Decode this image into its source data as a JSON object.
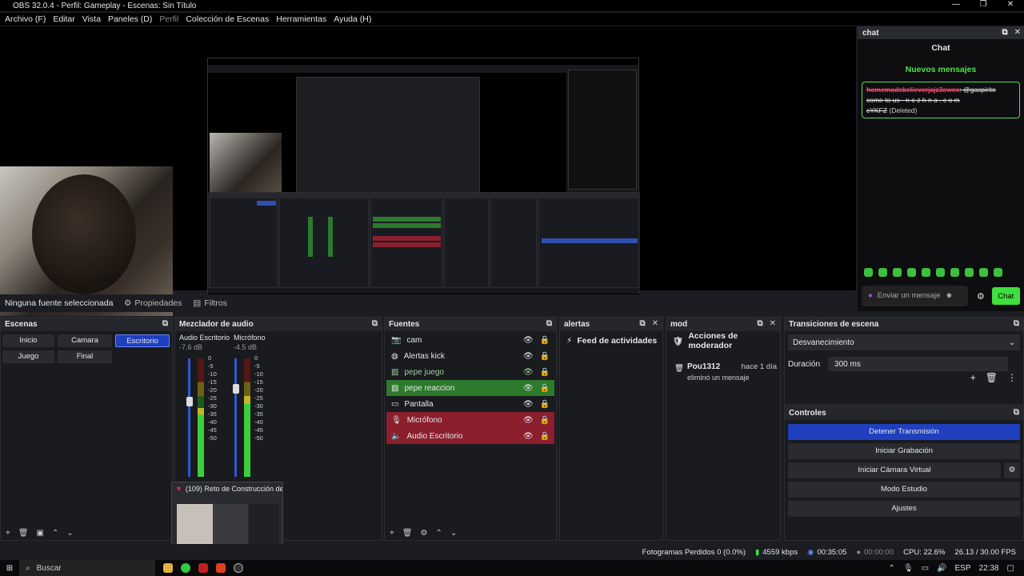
{
  "window": {
    "title": "OBS 32.0.4 - Perfil: Gameplay - Escenas: Sin Título",
    "min": "—",
    "max": "❐",
    "close": "✕"
  },
  "menu": [
    "Archivo (F)",
    "Editar",
    "Vista",
    "Paneles (D)",
    "Perfil",
    "Colección de Escenas",
    "Herramientas",
    "Ayuda (H)"
  ],
  "chat": {
    "dock_title": "chat",
    "title": "Chat",
    "new_messages": "Nuevos mensajes",
    "msg_user": "homemadebelieverjajz3ewex",
    "msg_text_a": ": @gaspirito",
    "msg_text_b": "come to us - n e z h n a . c o m",
    "msg_text_c": "cYKFZ",
    "msg_deleted": "(Deleted)",
    "input_placeholder": "Enviar un mensaje",
    "send_label": "Chat"
  },
  "source_bar": {
    "no_source": "Ninguna fuente seleccionada",
    "properties": "Propiedades",
    "filters": "Filtros"
  },
  "scenes": {
    "title": "Escenas",
    "items": [
      "Inicio",
      "Camara",
      "Escritorio",
      "Juego",
      "Final"
    ],
    "selected": "Escritorio"
  },
  "mixer": {
    "title": "Mezclador de audio",
    "channels": [
      {
        "name": "Audio Escritorio",
        "db": "-7.6 dB",
        "level": 0.58
      },
      {
        "name": "Micrófono",
        "db": "-4.5 dB",
        "level": 0.68
      }
    ],
    "ticks": [
      "0",
      "-5",
      "-10",
      "-15",
      "-20",
      "-25",
      "-30",
      "-35",
      "-40",
      "-45",
      "-50"
    ]
  },
  "sources": {
    "title": "Fuentes",
    "items": [
      {
        "label": "cam",
        "style": "normal",
        "icon": "camera-icon"
      },
      {
        "label": "Alertas kick",
        "style": "normal",
        "icon": "globe-icon"
      },
      {
        "label": "pepe juego",
        "style": "dim",
        "icon": "image-icon"
      },
      {
        "label": "pepe reaccion",
        "style": "green",
        "icon": "image-icon"
      },
      {
        "label": "Pantalla",
        "style": "normal",
        "icon": "monitor-icon"
      },
      {
        "label": "Micrófono",
        "style": "red",
        "icon": "microphone-icon"
      },
      {
        "label": "Audio Escritorio",
        "style": "red",
        "icon": "speaker-icon"
      }
    ]
  },
  "alertas": {
    "title": "alertas",
    "feed": "Feed de actividades"
  },
  "mod": {
    "title": "mod",
    "heading": "Acciones de moderador",
    "user": "Pou1312",
    "time": "hace 1 día",
    "action": "eliminó un mensaje"
  },
  "transitions": {
    "title": "Transiciones de escena",
    "selected": "Desvanecimiento",
    "duration_label": "Duración",
    "duration_value": "300 ms"
  },
  "controls": {
    "title": "Controles",
    "buttons": [
      "Detener Transmisión",
      "Iniciar Grabación",
      "Iniciar Cámara Virtual",
      "Modo Estudio",
      "Ajustes"
    ]
  },
  "status": {
    "dropped": "Fotogramas Perdidos 0 (0.0%)",
    "bitrate": "4559 kbps",
    "stream_time": "00:35:05",
    "rec_time": "00:00:00",
    "cpu": "CPU: 22.6%",
    "fps": "26.13 / 30.00 FPS"
  },
  "thumbnail": {
    "title": "(109) Reto de Construcción de ..."
  },
  "taskbar": {
    "search": "Buscar",
    "lang": "ESP",
    "time": "22:38"
  }
}
